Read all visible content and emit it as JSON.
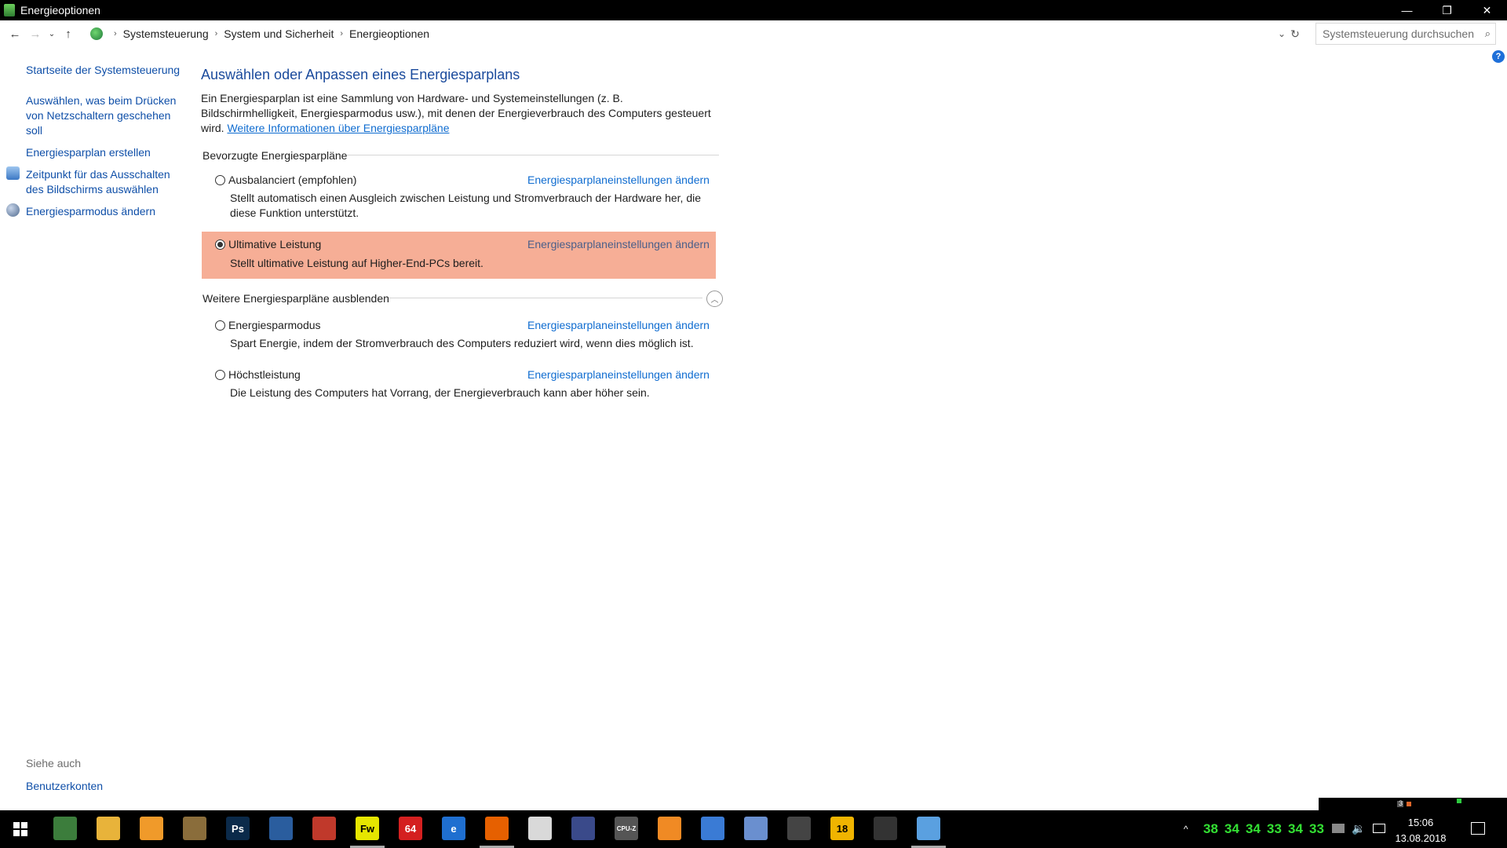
{
  "window": {
    "title": "Energieoptionen",
    "controls": {
      "minimize": "—",
      "restore": "❐",
      "close": "✕"
    }
  },
  "addressbar": {
    "back": "←",
    "forward": "→",
    "recent": "⌄",
    "up": "↑",
    "breadcrumbs": [
      "Systemsteuerung",
      "System und Sicherheit",
      "Energieoptionen"
    ],
    "separator": "›",
    "dropdown": "⌄",
    "refresh": "↻",
    "search_placeholder": "Systemsteuerung durchsuchen",
    "search_icon": "⌕"
  },
  "help": "?",
  "sidebar": {
    "items": [
      {
        "label": "Startseite der Systemsteuerung",
        "icon": ""
      },
      {
        "label": "Auswählen, was beim Drücken von Netzschaltern geschehen soll",
        "icon": ""
      },
      {
        "label": "Energiesparplan erstellen",
        "icon": ""
      },
      {
        "label": "Zeitpunkt für das Ausschalten des Bildschirms auswählen",
        "icon": "monitor-icon"
      },
      {
        "label": "Energiesparmodus ändern",
        "icon": "moon-icon"
      }
    ],
    "see_also_label": "Siehe auch",
    "see_also_items": [
      "Benutzerkonten"
    ]
  },
  "main": {
    "title": "Auswählen oder Anpassen eines Energiesparplans",
    "intro_text": "Ein Energiesparplan ist eine Sammlung von Hardware- und Systemeinstellungen (z. B. Bildschirmhelligkeit, Energiesparmodus usw.), mit denen der Energieverbrauch des Computers gesteuert wird. ",
    "intro_link": "Weitere Informationen über Energiesparpläne",
    "preferred_header": "Bevorzugte Energiesparpläne",
    "more_header": "Weitere Energiesparpläne ausblenden",
    "collapse_icon": "︿",
    "plans": [
      {
        "name": "Ausbalanciert (empfohlen)",
        "selected": false,
        "link": "Energiesparplaneinstellungen ändern",
        "description": "Stellt automatisch einen Ausgleich zwischen Leistung und Stromverbrauch der Hardware her, die diese Funktion unterstützt."
      },
      {
        "name": "Ultimative Leistung",
        "selected": true,
        "link": "Energiesparplaneinstellungen ändern",
        "description": "Stellt ultimative Leistung auf Higher-End-PCs bereit."
      },
      {
        "name": "Energiesparmodus",
        "selected": false,
        "link": "Energiesparplaneinstellungen ändern",
        "description": "Spart Energie, indem der Stromverbrauch des Computers reduziert wird, wenn dies möglich ist."
      },
      {
        "name": "Höchstleistung",
        "selected": false,
        "link": "Energiesparplaneinstellungen ändern",
        "description": "Die Leistung des Computers hat Vorrang, der Energieverbrauch kann aber höher sein."
      }
    ],
    "selected_highlight_color": "#f6ae96",
    "link_color": "#0f6cd0"
  },
  "strip": {
    "number": "3"
  },
  "taskbar": {
    "start_icon": "windows-logo-icon",
    "apps": [
      {
        "icon": "monitor-app-icon",
        "label": "",
        "color": "#3c7d3c"
      },
      {
        "icon": "file-explorer-icon",
        "label": "",
        "color": "#e8b33a"
      },
      {
        "icon": "media-player-icon",
        "label": "",
        "color": "#f09a2a"
      },
      {
        "icon": "image-viewer-icon",
        "label": "",
        "color": "#8a6d3b"
      },
      {
        "icon": "photoshop-icon",
        "label": "Ps",
        "color": "#0b2a4a"
      },
      {
        "icon": "thunderbird-icon",
        "label": "",
        "color": "#2a5d9e"
      },
      {
        "icon": "ccleaner-icon",
        "label": "",
        "color": "#c0392b"
      },
      {
        "icon": "fireworks-icon",
        "label": "Fw",
        "color": "#e6e600"
      },
      {
        "icon": "aida64-icon",
        "label": "64",
        "color": "#d42020"
      },
      {
        "icon": "edge-icon",
        "label": "e",
        "color": "#1f6fd0"
      },
      {
        "icon": "firefox-icon",
        "label": "",
        "color": "#e66000"
      },
      {
        "icon": "office-icon",
        "label": "",
        "color": "#d9d9d9"
      },
      {
        "icon": "cinema4d-icon",
        "label": "",
        "color": "#3a4a8a"
      },
      {
        "icon": "cpu-z-icon",
        "label": "CPU-Z",
        "color": "#555555"
      },
      {
        "icon": "rss-icon",
        "label": "",
        "color": "#f08a24"
      },
      {
        "icon": "equalizer-icon",
        "label": "",
        "color": "#3a7bd5"
      },
      {
        "icon": "paint-icon",
        "label": "",
        "color": "#6a8fcf"
      },
      {
        "icon": "triangle-app-icon",
        "label": "",
        "color": "#444444"
      },
      {
        "icon": "count-18-icon",
        "label": "18",
        "color": "#f0b400"
      },
      {
        "icon": "arma-icon",
        "label": "",
        "color": "#333333"
      },
      {
        "icon": "control-panel-icon",
        "label": "",
        "color": "#5aa0e0"
      }
    ],
    "tray_chevron": "^",
    "temperatures": [
      "38",
      "34",
      "34",
      "33",
      "34",
      "33"
    ],
    "time": "15:06",
    "date": "13.08.2018",
    "notification_icon": "notification-icon"
  }
}
